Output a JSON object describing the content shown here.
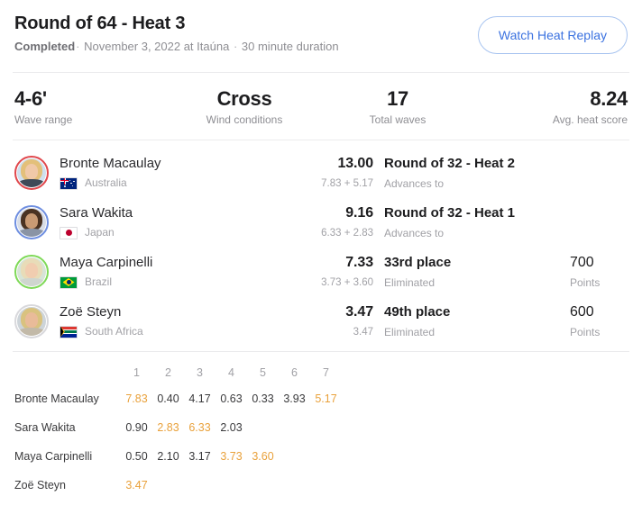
{
  "header": {
    "title": "Round of 64 - Heat 3",
    "status": "Completed",
    "meta": "November 3, 2022 at Itaúna",
    "duration": "30 minute duration",
    "separator": "·",
    "replay_button": "Watch Heat Replay"
  },
  "stats": [
    {
      "value": "4-6'",
      "label": "Wave range"
    },
    {
      "value": "Cross",
      "label": "Wind conditions"
    },
    {
      "value": "17",
      "label": "Total waves"
    },
    {
      "value": "8.24",
      "label": "Avg. heat score"
    }
  ],
  "athletes": [
    {
      "name": "Bronte Macaulay",
      "country": "Australia",
      "flag": "flag-australia",
      "ring_color": "#e0474c",
      "total": "13.00",
      "parts": "7.83 + 5.17",
      "next": "Round of 32 - Heat 2",
      "next_sub": "Advances to",
      "points": "",
      "points_label": ""
    },
    {
      "name": "Sara Wakita",
      "country": "Japan",
      "flag": "flag-japan",
      "ring_color": "#6e8ee0",
      "total": "9.16",
      "parts": "6.33 + 2.83",
      "next": "Round of 32 - Heat 1",
      "next_sub": "Advances to",
      "points": "",
      "points_label": ""
    },
    {
      "name": "Maya Carpinelli",
      "country": "Brazil",
      "flag": "flag-brazil",
      "ring_color": "#7ed957",
      "total": "7.33",
      "parts": "3.73 + 3.60",
      "next": "33rd place",
      "next_sub": "Eliminated",
      "points": "700",
      "points_label": "Points"
    },
    {
      "name": "Zoë Steyn",
      "country": "South Africa",
      "flag": "flag-south-africa",
      "ring_color": "#d8d8dc",
      "total": "3.47",
      "parts": "3.47",
      "next": "49th place",
      "next_sub": "Eliminated",
      "points": "600",
      "points_label": "Points"
    }
  ],
  "wave_table": {
    "columns": [
      "1",
      "2",
      "3",
      "4",
      "5",
      "6",
      "7"
    ],
    "rows": [
      {
        "name": "Bronte Macaulay",
        "scores": [
          "7.83",
          "0.40",
          "4.17",
          "0.63",
          "0.33",
          "3.93",
          "5.17"
        ],
        "highlight": [
          true,
          false,
          false,
          false,
          false,
          false,
          true
        ]
      },
      {
        "name": "Sara Wakita",
        "scores": [
          "0.90",
          "2.83",
          "6.33",
          "2.03",
          "",
          "",
          ""
        ],
        "highlight": [
          false,
          true,
          true,
          false,
          false,
          false,
          false
        ]
      },
      {
        "name": "Maya Carpinelli",
        "scores": [
          "0.50",
          "2.10",
          "3.17",
          "3.73",
          "3.60",
          "",
          ""
        ],
        "highlight": [
          false,
          false,
          false,
          true,
          true,
          false,
          false
        ]
      },
      {
        "name": "Zoë Steyn",
        "scores": [
          "3.47",
          "",
          "",
          "",
          "",
          "",
          ""
        ],
        "highlight": [
          true,
          false,
          false,
          false,
          false,
          false,
          false
        ]
      }
    ]
  },
  "colors": {
    "highlight": "#e9a13b",
    "accent": "#3b72e0",
    "muted": "#a1a1a6"
  }
}
